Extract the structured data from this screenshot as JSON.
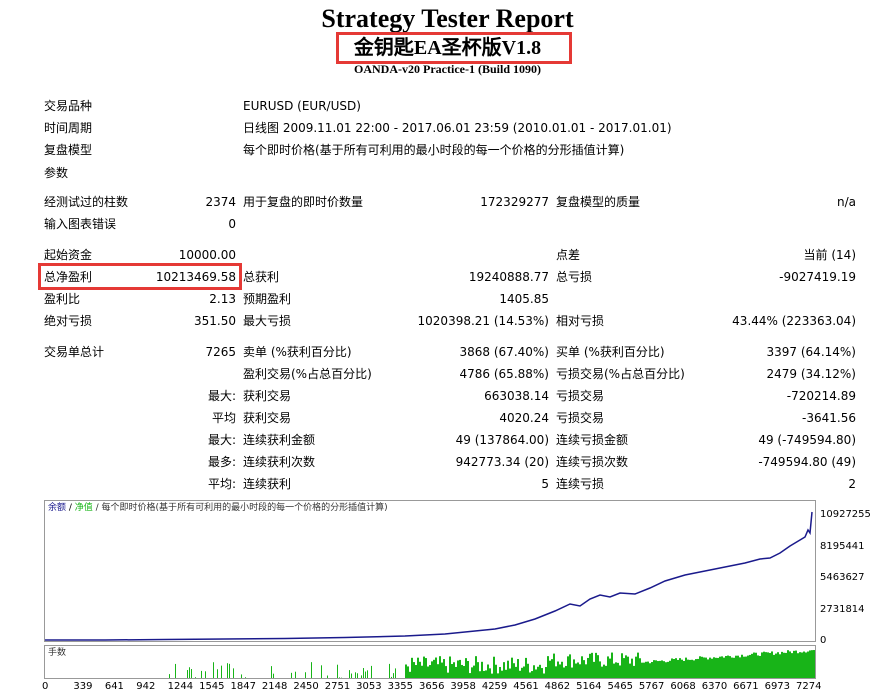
{
  "report": {
    "title": "Strategy Tester Report",
    "ea_name": "金钥匙EA圣杯版V1.8",
    "server": "OANDA-v20 Practice-1 (Build 1090)"
  },
  "header_rows": [
    {
      "label": "交易品种",
      "value": "EURUSD (EUR/USD)"
    },
    {
      "label": "时间周期",
      "value": "日线图 2009.11.01 22:00 - 2017.06.01 23:59 (2010.01.01 - 2017.01.01)"
    },
    {
      "label": "复盘模型",
      "value": "每个即时价格(基于所有可利用的最小时段的每一个价格的分形插值计算)"
    },
    {
      "label": "参数",
      "value": ""
    }
  ],
  "bars": {
    "label": "经测试过的柱数",
    "value": "2374",
    "ticks_label": "用于复盘的即时价数量",
    "ticks_value": "172329277",
    "quality_label": "复盘模型的质量",
    "quality_value": "n/a"
  },
  "errors": {
    "label": "输入图表错误",
    "value": "0"
  },
  "stats": {
    "initial_deposit_label": "起始资金",
    "initial_deposit": "10000.00",
    "spread_label": "点差",
    "spread_value": "当前 (14)",
    "net_profit_label": "总净盈利",
    "net_profit": "10213469.58",
    "gross_profit_label": "总获利",
    "gross_profit": "19240888.77",
    "gross_loss_label": "总亏损",
    "gross_loss": "-9027419.19",
    "profit_factor_label": "盈利比",
    "profit_factor": "2.13",
    "expected_payoff_label": "预期盈利",
    "expected_payoff": "1405.85",
    "abs_drawdown_label": "绝对亏损",
    "abs_drawdown": "351.50",
    "max_drawdown_label": "最大亏损",
    "max_drawdown": "1020398.21 (14.53%)",
    "rel_drawdown_label": "相对亏损",
    "rel_drawdown": "43.44% (223363.04)"
  },
  "trades": {
    "total_label": "交易单总计",
    "total": "7265",
    "short_label": "卖单 (%获利百分比)",
    "short": "3868 (67.40%)",
    "long_label": "买单 (%获利百分比)",
    "long": "3397 (64.14%)",
    "profit_trades_label": "盈利交易(%占总百分比)",
    "profit_trades": "4786 (65.88%)",
    "loss_trades_label": "亏损交易(%占总百分比)",
    "loss_trades": "2479 (34.12%)",
    "largest_prefix": "最大:",
    "largest_profit_label": "获利交易",
    "largest_profit": "663038.14",
    "largest_loss_label": "亏损交易",
    "largest_loss": "-720214.89",
    "average_prefix": "平均",
    "avg_profit_label": "获利交易",
    "avg_profit": "4020.24",
    "avg_loss_label": "亏损交易",
    "avg_loss": "-3641.56",
    "max_prefix": "最大:",
    "max_cons_wins_label": "连续获利金额",
    "max_cons_wins": "49 (137864.00)",
    "max_cons_losses_label": "连续亏损金额",
    "max_cons_losses": "49 (-749594.80)",
    "most_prefix": "最多:",
    "max_cons_profit_label": "连续获利次数",
    "max_cons_profit": "942773.34 (20)",
    "max_cons_loss_label": "连续亏损次数",
    "max_cons_loss": "-749594.80 (49)",
    "avg2_prefix": "平均:",
    "avg_cons_wins_label": "连续获利",
    "avg_cons_wins": "5",
    "avg_cons_losses_label": "连续亏损",
    "avg_cons_losses": "2"
  },
  "chart": {
    "legend_balance": "余额",
    "legend_sep": " / ",
    "legend_equity": "净值",
    "legend_desc": " / 每个即时价格(基于所有可利用的最小时段的每一个价格的分形插值计算)",
    "volume_label": "手数",
    "y_ticks": [
      "10927255",
      "8195441",
      "5463627",
      "2731814",
      "0"
    ],
    "x_ticks": [
      "0",
      "339",
      "641",
      "942",
      "1244",
      "1545",
      "1847",
      "2148",
      "2450",
      "2751",
      "3053",
      "3355",
      "3656",
      "3958",
      "4259",
      "4561",
      "4862",
      "5164",
      "5465",
      "5767",
      "6068",
      "6370",
      "6671",
      "6973",
      "7274"
    ],
    "balance_color": "#1a1a8c",
    "volume_color": "#18b418",
    "highlight_color": "#e53935"
  }
}
